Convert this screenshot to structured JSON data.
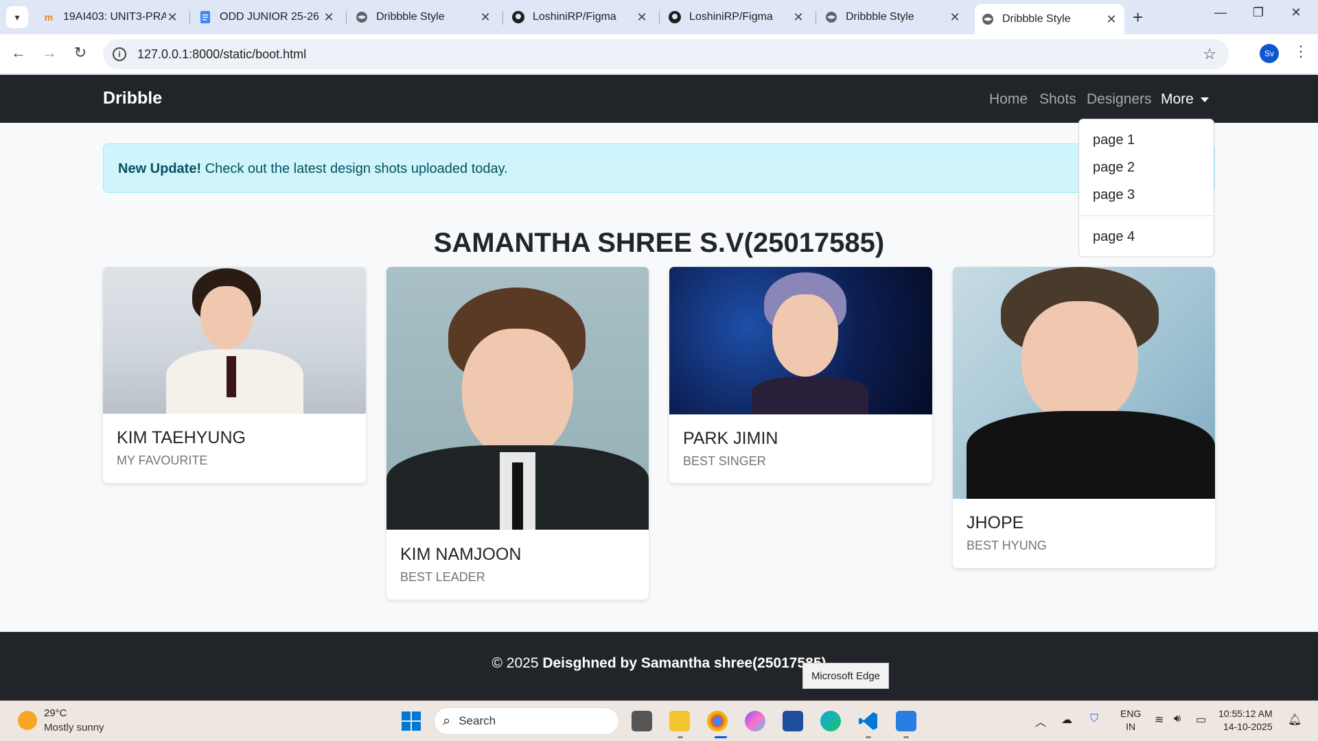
{
  "browser": {
    "tabs": [
      {
        "title": "19AI403: UNIT3-PRA",
        "icon": "moodle-icon"
      },
      {
        "title": "ODD JUNIOR 25-26 (",
        "icon": "docs-icon"
      },
      {
        "title": "Dribbble Style",
        "icon": "globe-icon"
      },
      {
        "title": "LoshiniRP/Figma",
        "icon": "github-icon"
      },
      {
        "title": "LoshiniRP/Figma",
        "icon": "github-icon"
      },
      {
        "title": "Dribbble Style",
        "icon": "globe-icon"
      },
      {
        "title": "Dribbble Style",
        "icon": "globe-icon",
        "active": true
      }
    ],
    "url": "127.0.0.1:8000/static/boot.html",
    "profile_initials": "Sv"
  },
  "navbar": {
    "brand": "Dribble",
    "links": [
      "Home",
      "Shots",
      "Designers"
    ],
    "more": "More",
    "dropdown": [
      "page 1",
      "page 2",
      "page 3",
      "page 4"
    ]
  },
  "alert": {
    "strong": "New Update!",
    "text": " Check out the latest design shots uploaded today."
  },
  "heading": "SAMANTHA SHREE S.V(25017585)",
  "cards": [
    {
      "title": "KIM TAEHYUNG",
      "subtitle": "MY FAVOURITE"
    },
    {
      "title": "KIM NAMJOON",
      "subtitle": "BEST LEADER"
    },
    {
      "title": "PARK JIMIN",
      "subtitle": "BEST SINGER"
    },
    {
      "title": "JHOPE",
      "subtitle": "BEST HYUNG"
    }
  ],
  "footer": {
    "prefix": "© 2025 ",
    "strong": "Deisghned by Samantha shree(25017585)"
  },
  "tooltip": "Microsoft Edge",
  "taskbar": {
    "weather_temp": "29°C",
    "weather_desc": "Mostly sunny",
    "search": "Search",
    "lang_line1": "ENG",
    "lang_line2": "IN",
    "time": "10:55:12 AM",
    "date": "14-10-2025"
  },
  "colors": {
    "navbar_bg": "#212529",
    "alert_bg": "#cff4fc",
    "alert_text": "#055160"
  }
}
